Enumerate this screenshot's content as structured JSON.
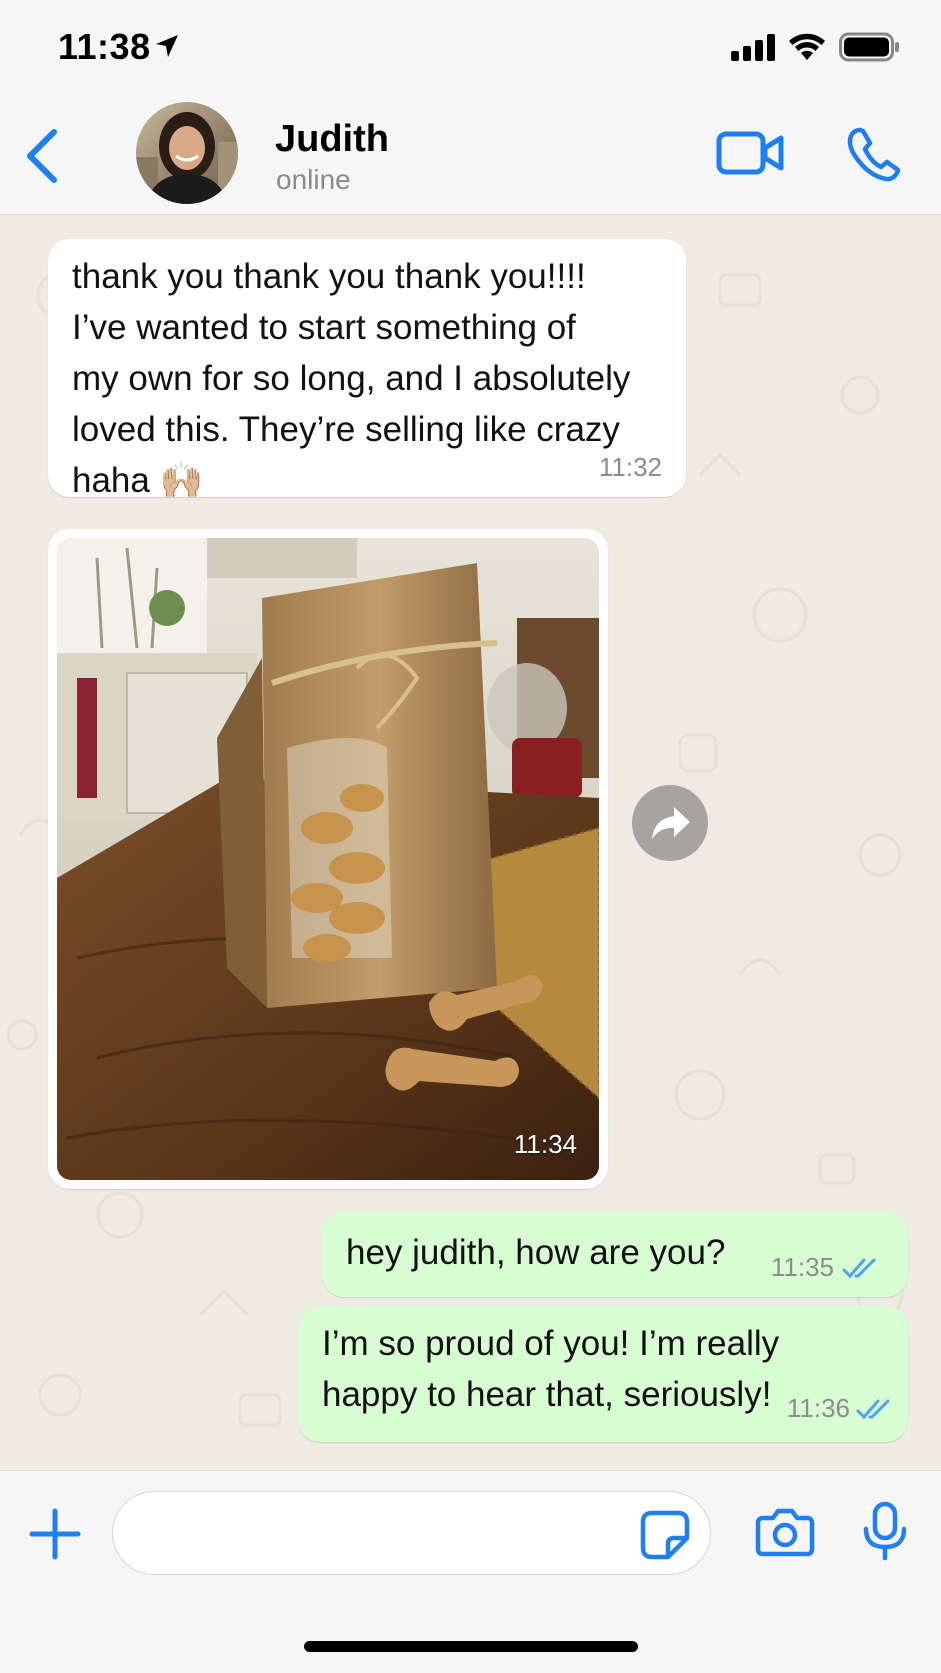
{
  "status_bar": {
    "time": "11:38"
  },
  "header": {
    "contact_name": "Judith",
    "contact_status": "online"
  },
  "messages": [
    {
      "direction": "incoming",
      "lines": [
        "thank you thank you thank you!!!!",
        "I’ve wanted to start something of",
        "my own for so long, and I absolutely",
        "loved this. They’re selling like crazy",
        "haha 🙌🏼"
      ],
      "time": "11:32"
    },
    {
      "direction": "incoming",
      "type": "photo",
      "description": "paper bag of dog biscuits",
      "time": "11:34"
    },
    {
      "direction": "outgoing",
      "lines": [
        "hey judith, how are you?"
      ],
      "time": "11:35",
      "status": "read"
    },
    {
      "direction": "outgoing",
      "lines": [
        "I’m so proud of you! I’m really",
        "happy to hear that, seriously!"
      ],
      "time": "11:36",
      "status": "read"
    }
  ],
  "composer": {
    "placeholder": ""
  },
  "colors": {
    "accent": "#1f7ff0",
    "incoming_bubble": "#ffffff",
    "outgoing_bubble": "#d9fdd3",
    "chat_background": "#efeae2"
  },
  "icons": [
    "back-chevron-icon",
    "video-call-icon",
    "phone-icon",
    "forward-icon",
    "plus-icon",
    "sticker-icon",
    "camera-icon",
    "microphone-icon"
  ]
}
